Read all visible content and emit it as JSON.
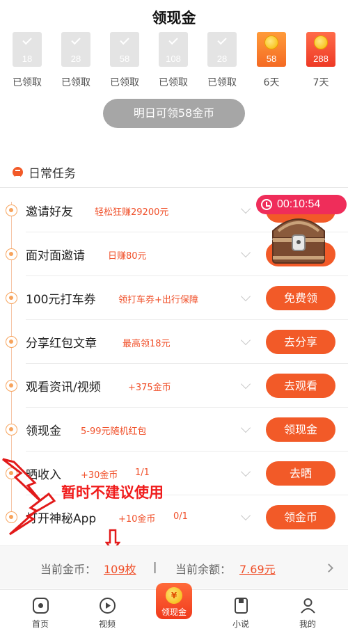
{
  "page": {
    "title": "领现金"
  },
  "checkin": {
    "days": [
      {
        "amount": "18",
        "label": "已领取",
        "state": "claimed"
      },
      {
        "amount": "28",
        "label": "已领取",
        "state": "claimed"
      },
      {
        "amount": "58",
        "label": "已领取",
        "state": "claimed"
      },
      {
        "amount": "108",
        "label": "已领取",
        "state": "claimed"
      },
      {
        "amount": "28",
        "label": "已领取",
        "state": "claimed"
      },
      {
        "amount": "58",
        "label": "6天",
        "state": "upcoming"
      },
      {
        "amount": "288",
        "label": "7天",
        "state": "upcoming"
      }
    ],
    "tomorrow_button": "明日可领58金币"
  },
  "daily": {
    "title": "日常任务",
    "timer": "00:10:54",
    "tasks": [
      {
        "name": "邀请好友",
        "reward": "轻松狂赚29200元",
        "progress": "",
        "button": ""
      },
      {
        "name": "面对面邀请",
        "reward": "日赚80元",
        "progress": "",
        "button": ""
      },
      {
        "name": "100元打车券",
        "reward": "领打车券+出行保障",
        "progress": "",
        "button": "免费领"
      },
      {
        "name": "分享红包文章",
        "reward": "最高领18元",
        "progress": "",
        "button": "去分享"
      },
      {
        "name": "观看资讯/视频",
        "reward": "+375金币",
        "progress": "",
        "button": "去观看"
      },
      {
        "name": "领现金",
        "reward": "5-99元随机红包",
        "progress": "",
        "button": "领现金"
      },
      {
        "name": "晒收入",
        "reward": "+30金币",
        "progress": "1/1",
        "button": "去晒"
      },
      {
        "name": "打开神秘App",
        "reward": "+10金币",
        "progress": "0/1",
        "button": "领金币"
      }
    ]
  },
  "annotation": {
    "text": "暂时不建议使用"
  },
  "balance": {
    "coins_label": "当前金币：",
    "coins_value": "109枚",
    "separator": "|",
    "cash_label": "当前余额：",
    "cash_value": "7.69元"
  },
  "tabs": [
    {
      "label": "首页",
      "icon": "home-icon"
    },
    {
      "label": "视频",
      "icon": "play-icon"
    },
    {
      "label": "领现金",
      "icon": "coin-icon"
    },
    {
      "label": "小说",
      "icon": "book-icon"
    },
    {
      "label": "我的",
      "icon": "user-icon"
    }
  ],
  "colors": {
    "accent": "#f25a28",
    "timer": "#ef2d5a",
    "annotation": "#f01c1c",
    "disabled": "#a6a6a6"
  }
}
